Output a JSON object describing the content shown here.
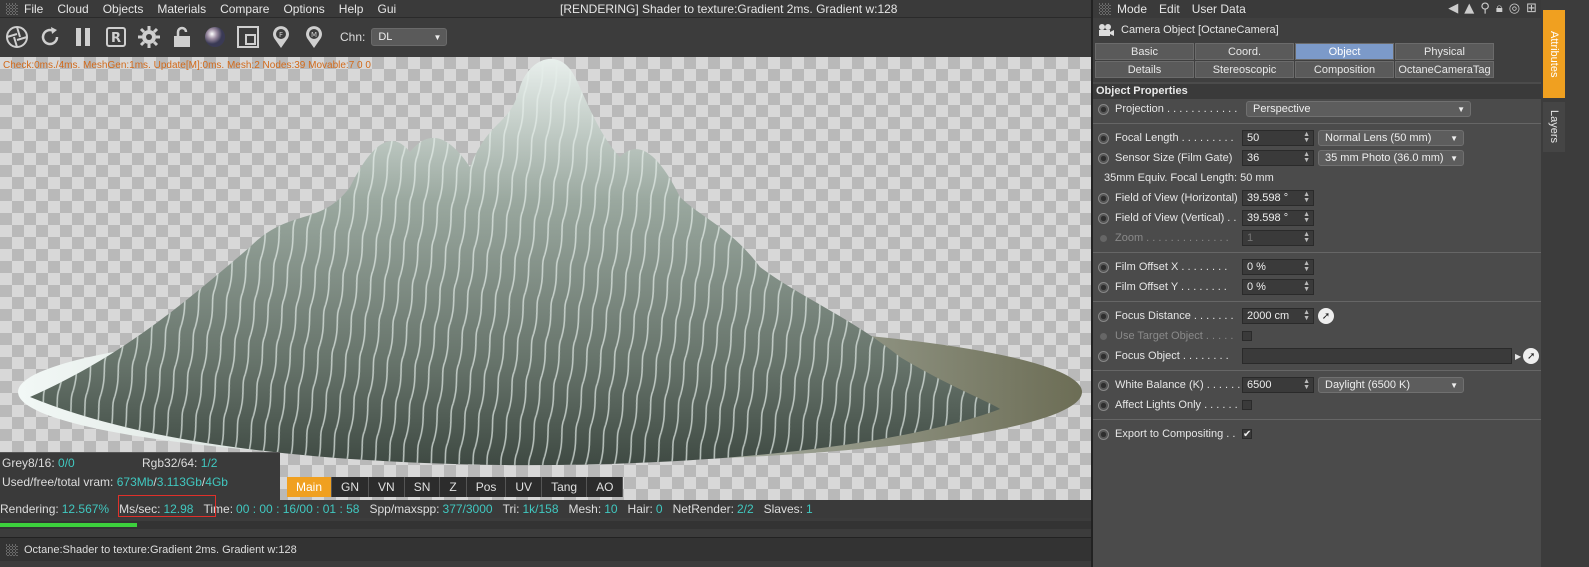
{
  "viewer": {
    "menu": [
      "File",
      "Cloud",
      "Objects",
      "Materials",
      "Compare",
      "Options",
      "Help",
      "Gui"
    ],
    "title": "[RENDERING] Shader to texture:Gradient  2ms. Gradient w:128",
    "toolbar_icons": [
      "aperture-icon",
      "refresh-icon",
      "pause-icon",
      "r-icon",
      "gear-icon",
      "lock-icon",
      "sphere-icon",
      "region-icon",
      "f-pin-icon",
      "m-pin-icon"
    ],
    "chn_label": "Chn:",
    "chn_value": "DL",
    "check_line": "Check:0ms./4ms. MeshGen:1ms. Update[M]:0ms. Mesh:2 Nodes:39 Movable:7  0 0",
    "stats": {
      "grey_label": "Grey8/16:",
      "grey_value": "0/0",
      "rgb_label": "Rgb32/64:",
      "rgb_value": "1/2",
      "vram_label": "Used/free/total vram:",
      "vram_used": "673Mb",
      "vram_free": "3.113Gb",
      "vram_total": "4Gb",
      "sep": "/"
    },
    "passes": [
      "Main",
      "GN",
      "VN",
      "SN",
      "Z",
      "Pos",
      "UV",
      "Tang",
      "AO"
    ],
    "active_pass": "Main",
    "status": {
      "rendering_label": "Rendering:",
      "rendering_value": "12.567%",
      "mssec_label": "Ms/sec:",
      "mssec_value": "12.98",
      "time_label": "Time:",
      "time_value": "00 : 00 : 16/00 : 01 : 58",
      "spp_label": "Spp/maxspp:",
      "spp_value": "377/3000",
      "tri_label": "Tri:",
      "tri_value": "1k/158",
      "mesh_label": "Mesh:",
      "mesh_value": "10",
      "hair_label": "Hair:",
      "hair_value": "0",
      "net_label": "NetRender:",
      "net_value": "2/2",
      "slaves_label": "Slaves:",
      "slaves_value": "1"
    },
    "progress": 0.12567,
    "bottom_text": "Octane:Shader to texture:Gradient  2ms. Gradient w:128"
  },
  "attributes": {
    "menu": [
      "Mode",
      "Edit",
      "User Data"
    ],
    "object_title": "Camera Object [OctaneCamera]",
    "tabs": [
      "Basic",
      "Coord.",
      "Object",
      "Physical",
      "Details",
      "Stereoscopic",
      "Composition",
      "OctaneCameraTag"
    ],
    "active_tab": "Object",
    "section": "Object Properties",
    "projection_label": "Projection . . . . . . . . . . . .",
    "projection_value": "Perspective",
    "focal_label": "Focal Length  . . . . . . . . .",
    "focal_value": "50",
    "focal_preset": "Normal Lens (50 mm)",
    "sensor_label": "Sensor Size (Film Gate)",
    "sensor_value": "36",
    "sensor_preset": "35 mm Photo (36.0 mm)",
    "equiv_text": "35mm Equiv. Focal Length: 50 mm",
    "fovh_label": "Field of View (Horizontal)",
    "fovh_value": "39.598 °",
    "fovv_label": "Field of View (Vertical) . .",
    "fovv_value": "39.598 °",
    "zoom_label": "Zoom  . . . . . . . . . . . . . .",
    "zoom_value": "1",
    "offx_label": "Film Offset X  . . . . . . . .",
    "offx_value": "0 %",
    "offy_label": "Film Offset Y  . . . . . . . .",
    "offy_value": "0 %",
    "focusdist_label": "Focus Distance  . . . . . . .",
    "focusdist_value": "2000 cm",
    "usetarget_label": "Use Target Object  . . . . .",
    "focusobj_label": "Focus Object  . . . . . . . .",
    "wb_label": "White Balance (K) . . . . . .",
    "wb_value": "6500",
    "wb_preset": "Daylight (6500 K)",
    "affect_label": "Affect Lights Only . . . . . .",
    "export_label": "Export to Compositing . .",
    "export_check": "✔"
  },
  "side_tabs": {
    "attributes": "Attributes",
    "layers": "Layers"
  }
}
